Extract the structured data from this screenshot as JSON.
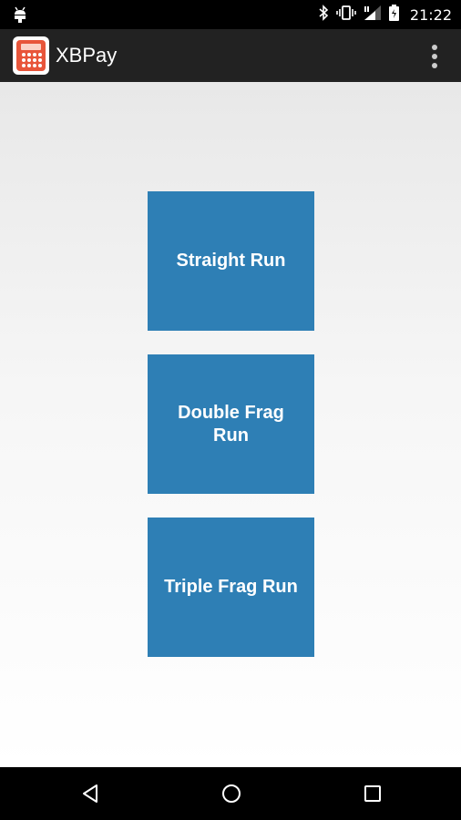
{
  "status_bar": {
    "time": "21:22",
    "icons": [
      "android-debug-icon",
      "bluetooth-icon",
      "vibrate-icon",
      "signal-icon",
      "battery-icon"
    ]
  },
  "app_bar": {
    "title": "XBPay",
    "app_icon": "calculator-icon",
    "menu_icon": "overflow-menu-icon"
  },
  "buttons": {
    "straight_run": "Straight Run",
    "double_frag_run": "Double Frag Run",
    "triple_frag_run": "Triple Frag Run"
  },
  "nav_bar": {
    "icons": [
      "back-icon",
      "home-icon",
      "recents-icon"
    ]
  },
  "colors": {
    "button": "#2e7fb5",
    "app_bar": "#222222",
    "app_icon": "#e8553a"
  }
}
